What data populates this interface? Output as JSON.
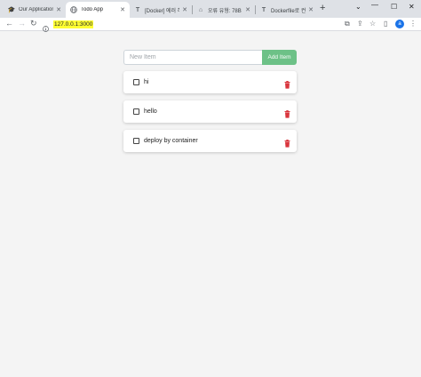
{
  "browser": {
    "tabs": [
      {
        "title": "Our Application",
        "icon": "graduation-cap-icon",
        "active": false
      },
      {
        "title": "Todo App",
        "icon": "globe-icon",
        "active": true
      },
      {
        "title": "[Docker] 에러 해결",
        "icon": "t-logo-icon",
        "active": false
      },
      {
        "title": "오류 유형: 78B \"",
        "icon": "home-icon",
        "active": false
      },
      {
        "title": "Dockerfile로 컨테",
        "icon": "t-logo-icon",
        "active": false
      }
    ],
    "url": "127.0.0.1:3000",
    "profile_initial": "a"
  },
  "app": {
    "input_placeholder": "New Item",
    "add_button_label": "Add Item",
    "accent_color": "#6dc187",
    "delete_color": "#d9363e",
    "items": [
      {
        "name": "hi",
        "completed": false
      },
      {
        "name": "hello",
        "completed": false
      },
      {
        "name": "deploy by container",
        "completed": false
      }
    ]
  }
}
